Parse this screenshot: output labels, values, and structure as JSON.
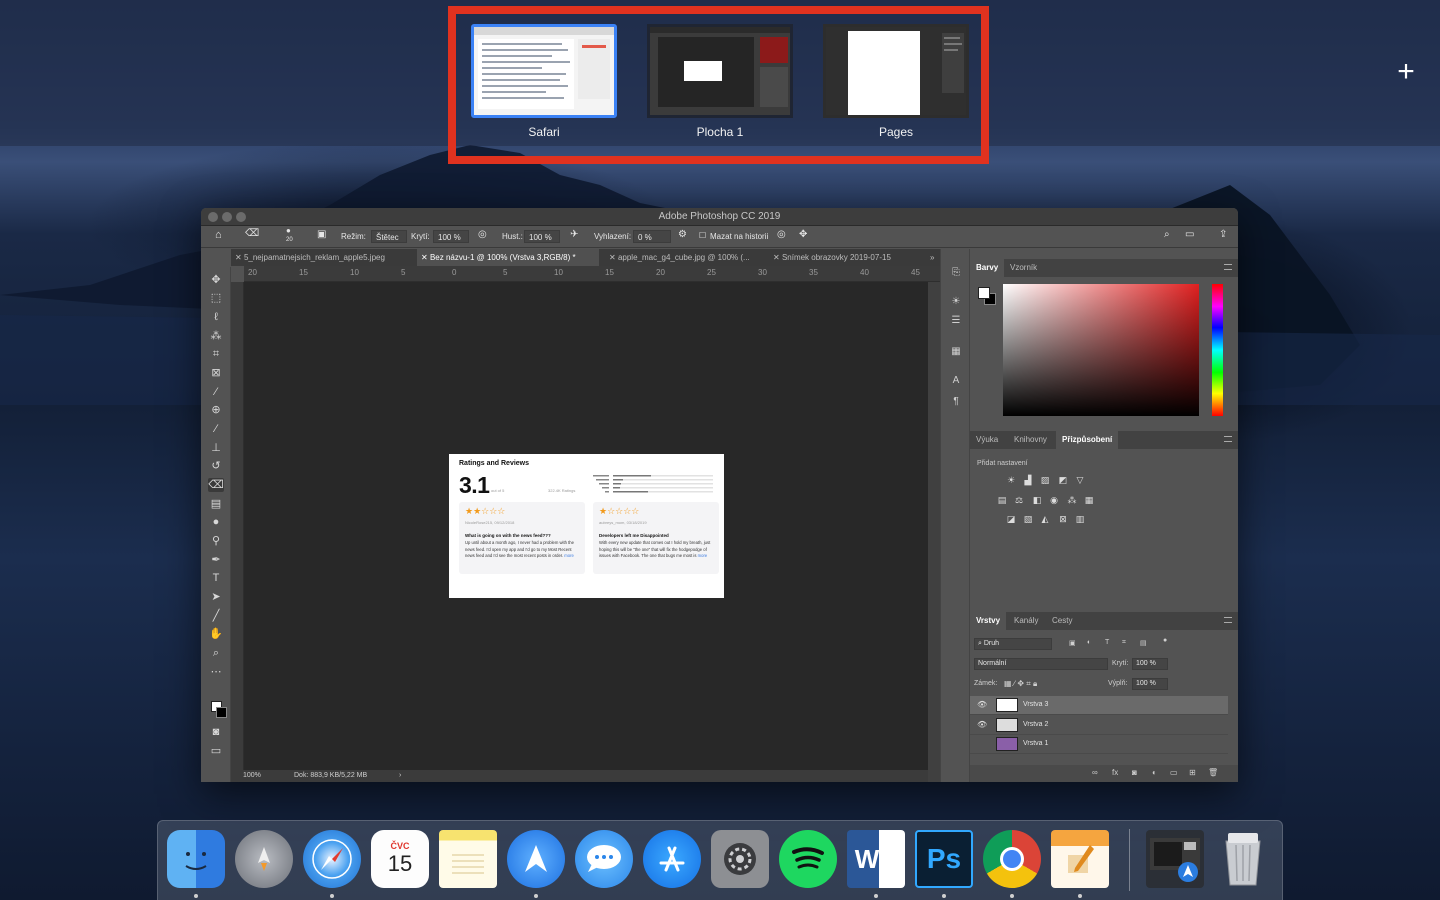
{
  "spaces": {
    "items": [
      {
        "label": "Safari",
        "active": true
      },
      {
        "label": "Plocha 1",
        "active": false
      },
      {
        "label": "Pages",
        "active": false
      }
    ],
    "add_icon": "plus-icon",
    "highlight_color": "#e0321f"
  },
  "photoshop": {
    "window_title": "Adobe Photoshop CC 2019",
    "options_bar": {
      "brush_size": "20",
      "mode_label": "Režim:",
      "mode_value": "Štětec",
      "opacity_label": "Krytí:",
      "opacity_value": "100 %",
      "flow_label": "Hust.:",
      "flow_value": "100 %",
      "smoothing_label": "Vyhlazení:",
      "smoothing_value": "0 %",
      "erase_history_label": "Mazat na historii"
    },
    "tabs": [
      {
        "label": "5_nejpamatnejsich_reklam_apple5.jpeg",
        "active": false
      },
      {
        "label": "Bez názvu-1 @ 100% (Vrstva 3,RGB/8) *",
        "active": true
      },
      {
        "label": "apple_mac_g4_cube.jpg @ 100% (...",
        "active": false
      },
      {
        "label": "Snímek obrazovky 2019-07-15",
        "active": false
      }
    ],
    "ruler_h": [
      "20",
      "15",
      "10",
      "5",
      "0",
      "5",
      "10",
      "15",
      "20",
      "25",
      "30",
      "35",
      "40",
      "45"
    ],
    "document": {
      "title": "Ratings and Reviews",
      "rating": "3.1",
      "out_of": "out of 5",
      "ratings_count": "322.4K Ratings",
      "reviews": [
        {
          "stars": "★★☆☆☆",
          "author": "NicoleRose215, 09/12/2018",
          "title": "What is going on with the news feed???",
          "body": "Up until about a month ago, I never had a problem with the news feed. I'd open my app and I'd go to my Most Recent news feed and I'd see the most recent posts in order.",
          "more": "more"
        },
        {
          "stars": "★☆☆☆☆",
          "author": "aubreys_mom, 03/18/2019",
          "title": "Developers left me Disappointed",
          "body": "With every new update that comes out I hold my breath, just hoping this will be \"the one\" that will fix the hodgepodge of issues with Facebook. The one that bugs me most is",
          "more": "more"
        }
      ]
    },
    "status": {
      "zoom": "100%",
      "doc": "Dok: 883,9 KB/5,22 MB"
    },
    "color_panel": {
      "tabs": [
        "Barvy",
        "Vzorník"
      ]
    },
    "adjust_panel": {
      "tabs": [
        "Výuka",
        "Knihovny",
        "Přizpůsobení"
      ],
      "add_label": "Přidat nastavení"
    },
    "layers_panel": {
      "tabs": [
        "Vrstvy",
        "Kanály",
        "Cesty"
      ],
      "filter_label": "Druh",
      "blend_mode": "Normální",
      "opacity_label": "Krytí:",
      "opacity_value": "100 %",
      "lock_label": "Zámek:",
      "fill_label": "Výplň:",
      "fill_value": "100 %",
      "layers": [
        {
          "name": "Vrstva 3",
          "selected": true,
          "visible": true
        },
        {
          "name": "Vrstva 2",
          "selected": false,
          "visible": true
        },
        {
          "name": "Vrstva 1",
          "selected": false,
          "visible": false
        }
      ]
    }
  },
  "dock": {
    "items": [
      {
        "name": "finder-icon",
        "label": "",
        "color": "#3d8ee8",
        "running": true
      },
      {
        "name": "launchpad-icon",
        "label": "",
        "color": "#8a8f99",
        "running": false
      },
      {
        "name": "safari-icon",
        "label": "",
        "color": "#2c7de0",
        "running": true
      },
      {
        "name": "calendar-icon",
        "label": "15",
        "month": "ČVC",
        "color": "#ffffff",
        "running": false
      },
      {
        "name": "notes-icon",
        "label": "",
        "color": "#f5e27a",
        "running": false
      },
      {
        "name": "spark-icon",
        "label": "",
        "color": "#3a8cf0",
        "running": true
      },
      {
        "name": "messages-icon",
        "label": "",
        "color": "#4ba3f5",
        "running": false
      },
      {
        "name": "app-store-icon",
        "label": "",
        "color": "#1d8cf2",
        "running": false
      },
      {
        "name": "system-preferences-icon",
        "label": "",
        "color": "#7d7f84",
        "running": false
      },
      {
        "name": "spotify-icon",
        "label": "",
        "color": "#1ed760",
        "running": false
      },
      {
        "name": "word-icon",
        "label": "W",
        "color": "#2b5797",
        "running": true
      },
      {
        "name": "photoshop-icon",
        "label": "Ps",
        "color": "#0a1f33",
        "running": true
      },
      {
        "name": "chrome-icon",
        "label": "",
        "color": "#db4437",
        "running": true
      },
      {
        "name": "pages-icon",
        "label": "",
        "color": "#f2a03d",
        "running": true
      }
    ]
  }
}
